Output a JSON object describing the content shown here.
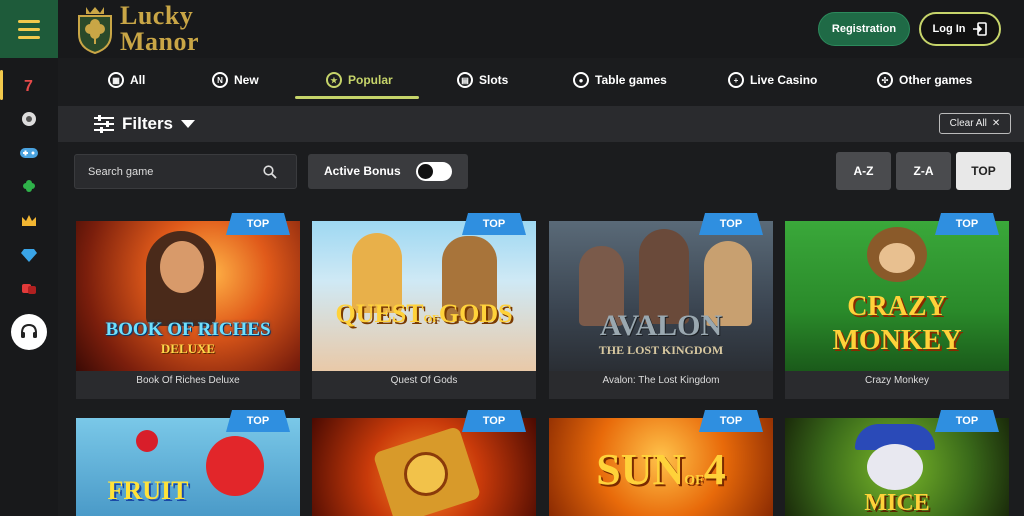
{
  "header": {
    "brand_line1": "Lucky",
    "brand_line2": "Manor",
    "registration_label": "Registration",
    "login_label": "Log In"
  },
  "sidebar": {
    "items": [
      "slot-machine-icon",
      "roulette-icon",
      "gamepad-icon",
      "clover-icon",
      "crown-icon",
      "diamond-icon",
      "dice-icon"
    ],
    "support_icon": "headset-icon"
  },
  "tabs": [
    {
      "label": "All",
      "icon": "grid-icon"
    },
    {
      "label": "New",
      "icon": "new-icon"
    },
    {
      "label": "Popular",
      "icon": "popular-icon",
      "active": true
    },
    {
      "label": "Slots",
      "icon": "slots-icon"
    },
    {
      "label": "Table games",
      "icon": "chip-icon"
    },
    {
      "label": "Live Casino",
      "icon": "live-icon"
    },
    {
      "label": "Other games",
      "icon": "other-games-icon"
    }
  ],
  "filters": {
    "label": "Filters",
    "clear_all_label": "Clear All"
  },
  "search": {
    "placeholder": "Search game"
  },
  "active_bonus": {
    "label": "Active Bonus",
    "enabled": false
  },
  "sort": [
    {
      "label": "A-Z",
      "active": false
    },
    {
      "label": "Z-A",
      "active": false
    },
    {
      "label": "TOP",
      "active": true
    }
  ],
  "badge_label": "TOP",
  "games": [
    {
      "name": "Book Of Riches Deluxe",
      "art_line1": "BOOK OF RICHES",
      "art_line2": "DELUXE"
    },
    {
      "name": "Quest Of Gods",
      "art_line1": "QUEST",
      "art_line2": "GODS",
      "art_small": "OF"
    },
    {
      "name": "Avalon: The Lost Kingdom",
      "art_line1": "AVALON",
      "art_line2": "THE LOST KINGDOM"
    },
    {
      "name": "Crazy Monkey",
      "art_line1": "CRAZY",
      "art_line2": "MONKEY"
    },
    {
      "name": "",
      "art_line1": "FRUIT"
    },
    {
      "name": ""
    },
    {
      "name": "",
      "art_line1": "SUN",
      "art_small": "OF",
      "art_num": "4"
    },
    {
      "name": "",
      "art_line1": "MICE"
    }
  ],
  "colors": {
    "accent": "#c6d46a",
    "brand_green": "#1f6a46",
    "gold": "#c9a646",
    "badge_blue": "#2f8fe0"
  }
}
